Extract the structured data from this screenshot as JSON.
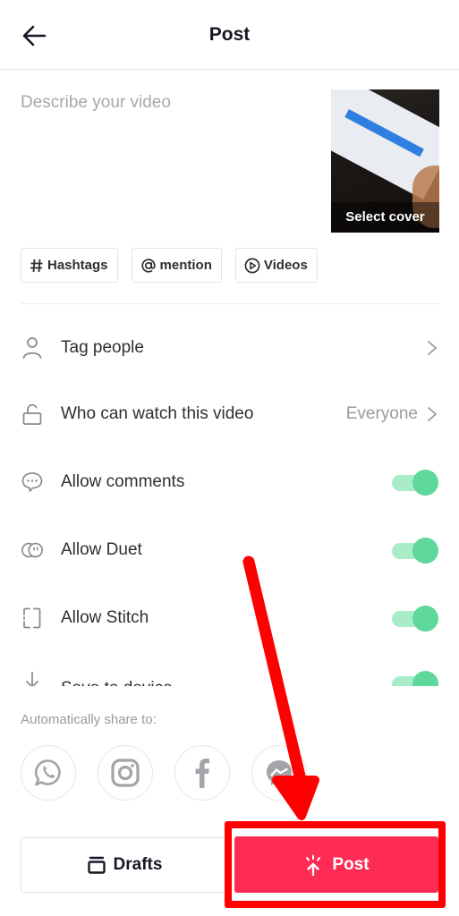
{
  "header": {
    "title": "Post",
    "back_icon": "arrow-left-icon"
  },
  "description": {
    "placeholder": "Describe your video"
  },
  "cover": {
    "label": "Select cover"
  },
  "chips": [
    {
      "icon": "hashtag-icon",
      "label": "Hashtags"
    },
    {
      "icon": "at-icon",
      "label": "mention"
    },
    {
      "icon": "play-circle-icon",
      "label": "Videos"
    }
  ],
  "settings": {
    "tag_people": {
      "icon": "person-icon",
      "label": "Tag people"
    },
    "who_can_watch": {
      "icon": "unlock-icon",
      "label": "Who can watch this video",
      "value": "Everyone"
    },
    "allow_comments": {
      "icon": "comment-icon",
      "label": "Allow comments",
      "enabled": true
    },
    "allow_duet": {
      "icon": "duet-icon",
      "label": "Allow Duet",
      "enabled": true
    },
    "allow_stitch": {
      "icon": "stitch-icon",
      "label": "Allow Stitch",
      "enabled": true
    },
    "save_to_device": {
      "icon": "download-icon",
      "label": "Save to device",
      "enabled": true
    }
  },
  "share": {
    "label": "Automatically share to:",
    "targets": [
      "whatsapp-icon",
      "instagram-icon",
      "facebook-icon",
      "messenger-icon"
    ]
  },
  "actions": {
    "drafts_label": "Drafts",
    "post_label": "Post"
  },
  "colors": {
    "post_accent": "#fe2c55",
    "toggle_on": "#5ed89b",
    "annotation": "#ff0000"
  }
}
